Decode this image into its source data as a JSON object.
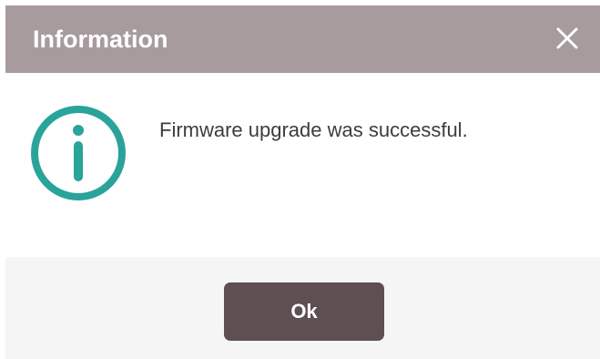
{
  "dialog": {
    "title": "Information",
    "close_icon": "close-icon",
    "message": "Firmware upgrade was successful.",
    "icon": "info-icon",
    "ok_label": "Ok"
  },
  "colors": {
    "titlebar": "#a89b9d",
    "icon_teal": "#2aa39b",
    "button": "#5e4f52",
    "footer": "#f5f5f5",
    "message_text": "#3d3d3d"
  }
}
